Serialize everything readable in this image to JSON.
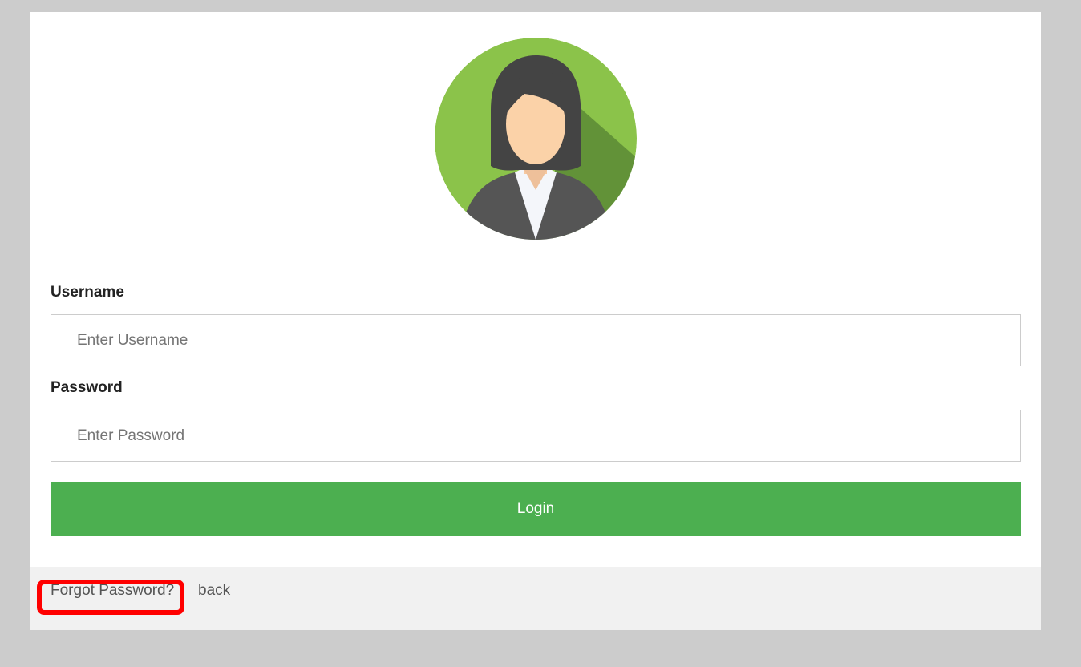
{
  "form": {
    "username_label": "Username",
    "username_placeholder": "Enter Username",
    "password_label": "Password",
    "password_placeholder": "Enter Password",
    "login_label": "Login"
  },
  "footer": {
    "forgot_password": "Forgot Password?",
    "back": "back"
  },
  "colors": {
    "page_background": "#cccccc",
    "accent_green": "#4caf50",
    "footer_background": "#f1f1f1",
    "highlight": "#ff0000"
  },
  "icons": {
    "avatar": "female-user-avatar-icon"
  }
}
